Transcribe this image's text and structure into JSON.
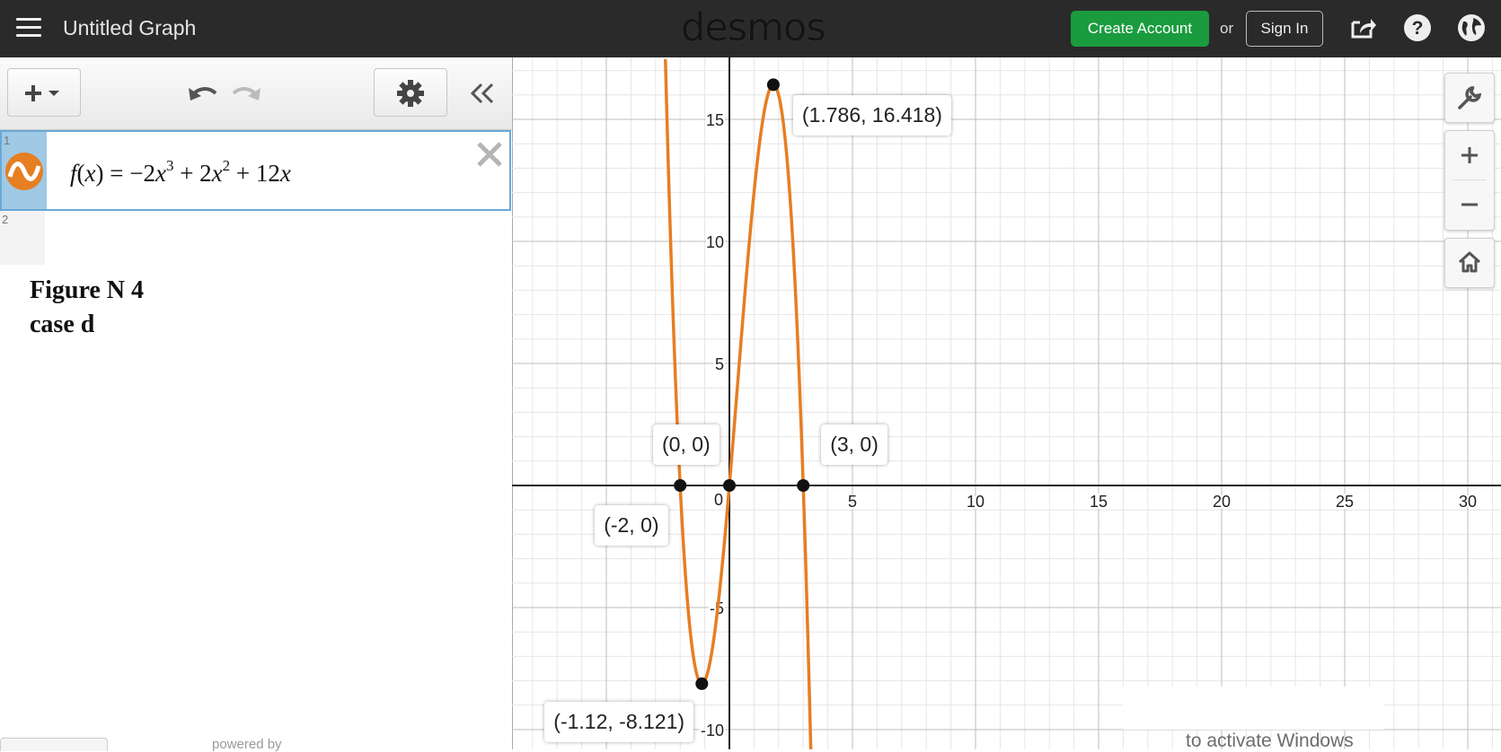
{
  "topbar": {
    "graph_title": "Untitled Graph",
    "logo": "desmos",
    "create_account": "Create Account",
    "or": "or",
    "sign_in": "Sign In"
  },
  "expressions": [
    {
      "index": "1",
      "latex": "f(x) = -2x^3 + 2x^2 + 12x",
      "color": "#e67e22"
    },
    {
      "index": "2",
      "latex": ""
    }
  ],
  "note": {
    "line1": "Figure N 4",
    "line2": "case d"
  },
  "footer": {
    "powered_by": "powered by",
    "watermark": "to activate Windows"
  },
  "graph": {
    "curve_color": "#e67e22",
    "axis_color": "#222222",
    "x_ticks": [
      "0",
      "5",
      "10",
      "15",
      "20",
      "25",
      "30"
    ],
    "y_ticks": [
      "15",
      "10",
      "5",
      "-5",
      "-10"
    ],
    "points": [
      {
        "label": "(1.786, 16.418)",
        "x": 1.786,
        "y": 16.418
      },
      {
        "label": "(0, 0)",
        "x": 0,
        "y": 0
      },
      {
        "label": "(-2, 0)",
        "x": -2,
        "y": 0
      },
      {
        "label": "(3, 0)",
        "x": 3,
        "y": 0
      },
      {
        "label": "(-1.12, -8.121)",
        "x": -1.12,
        "y": -8.121
      }
    ]
  },
  "chart_data": {
    "type": "line",
    "function": "f(x) = -2x^3 + 2x^2 + 12x",
    "xlim": [
      -8.6,
      31.5
    ],
    "ylim": [
      -10.8,
      17.2
    ],
    "x_ticks": [
      0,
      5,
      10,
      15,
      20,
      25,
      30
    ],
    "y_ticks": [
      -10,
      -5,
      5,
      10,
      15
    ],
    "grid": true,
    "series": [
      {
        "values": [
          {
            "x": -2.4,
            "y": 9.98
          },
          {
            "x": -2,
            "y": 0
          },
          {
            "x": -1.5,
            "y": -7.5
          },
          {
            "x": -1.12,
            "y": -8.121
          },
          {
            "x": -0.5,
            "y": -5.25
          },
          {
            "x": 0,
            "y": 0
          },
          {
            "x": 0.5,
            "y": 6.25
          },
          {
            "x": 1,
            "y": 12
          },
          {
            "x": 1.5,
            "y": 15.75
          },
          {
            "x": 1.786,
            "y": 16.418
          },
          {
            "x": 2,
            "y": 16
          },
          {
            "x": 2.5,
            "y": 11.25
          },
          {
            "x": 3,
            "y": 0
          },
          {
            "x": 3.3,
            "y": -10.21
          }
        ]
      }
    ],
    "annotations": [
      "(1.786, 16.418)",
      "(0, 0)",
      "(-2, 0)",
      "(3, 0)",
      "(-1.12, -8.121)"
    ]
  }
}
